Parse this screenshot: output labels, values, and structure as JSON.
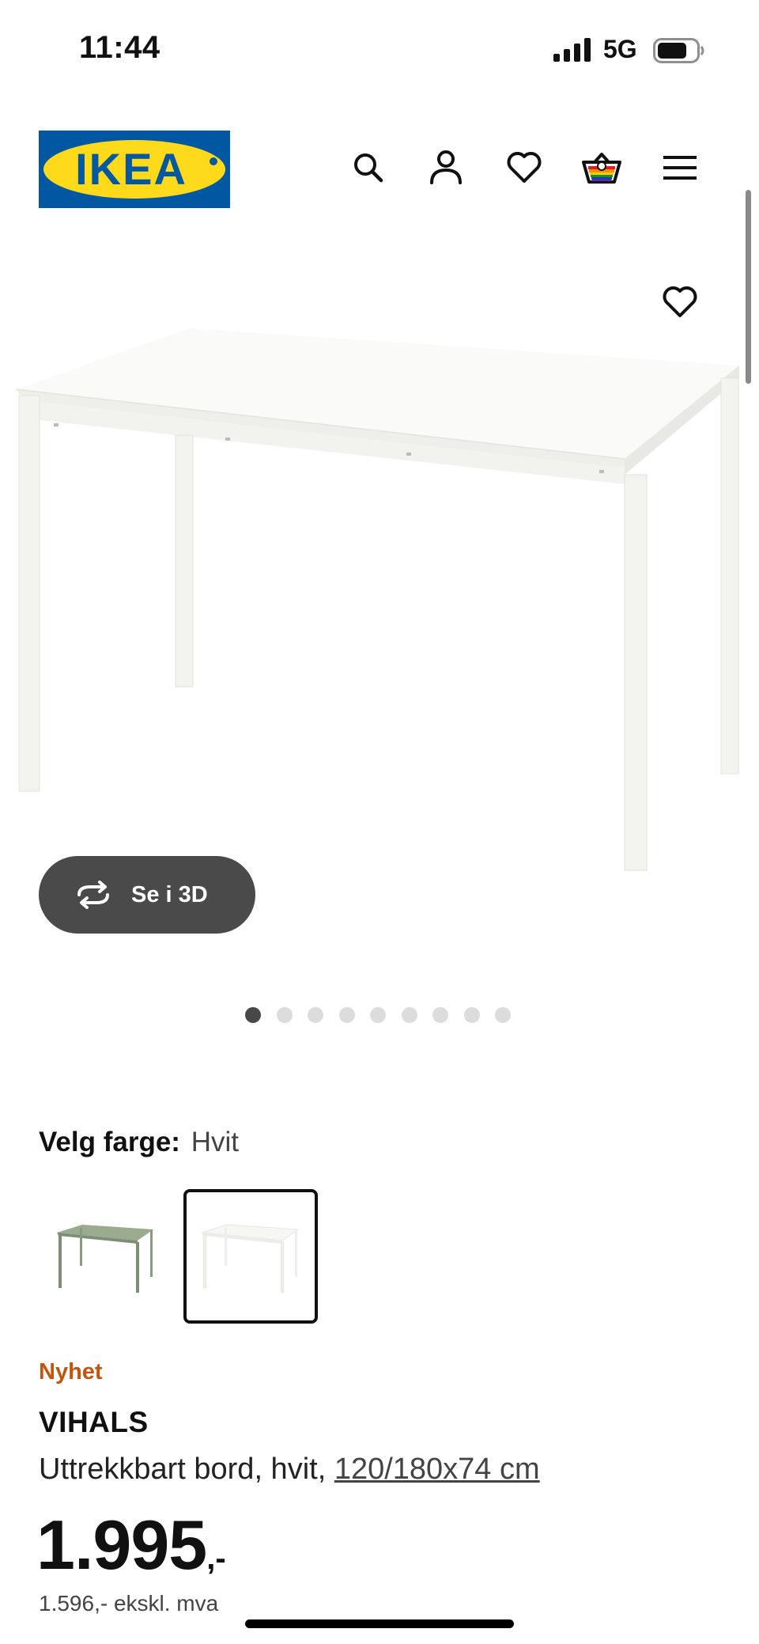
{
  "status_bar": {
    "time": "11:44",
    "network": "5G",
    "signal_bars": 4,
    "battery_level": 0.75
  },
  "header": {
    "logo_text": "IKEA",
    "logo_colors": {
      "background": "#0058A3",
      "oval": "#FFDA1A",
      "text": "#0058A3"
    },
    "icons": [
      "search-icon",
      "user-icon",
      "heart-icon",
      "basket-icon",
      "menu-icon"
    ]
  },
  "product_image": {
    "favorite_icon": "heart-outline-icon",
    "button_3d_label": "Se i 3D",
    "button_3d_icon": "rotate-icon",
    "carousel_total": 9,
    "carousel_active": 1
  },
  "color_picker": {
    "label": "Velg farge:",
    "selected_value": "Hvit",
    "swatches": [
      {
        "name": "Grønn",
        "color": "#8a9a80",
        "selected": false
      },
      {
        "name": "Hvit",
        "color": "#f4f4f2",
        "selected": true
      }
    ]
  },
  "product": {
    "badge": "Nyhet",
    "badge_color": "#C2550D",
    "name": "VIHALS",
    "description_prefix": "Uttrekkbart bord, hvit, ",
    "size_link": "120/180x74 cm",
    "price_main": "1.995",
    "price_suffix": ",-",
    "price_ex_vat": "1.596,- ekskl. mva"
  }
}
